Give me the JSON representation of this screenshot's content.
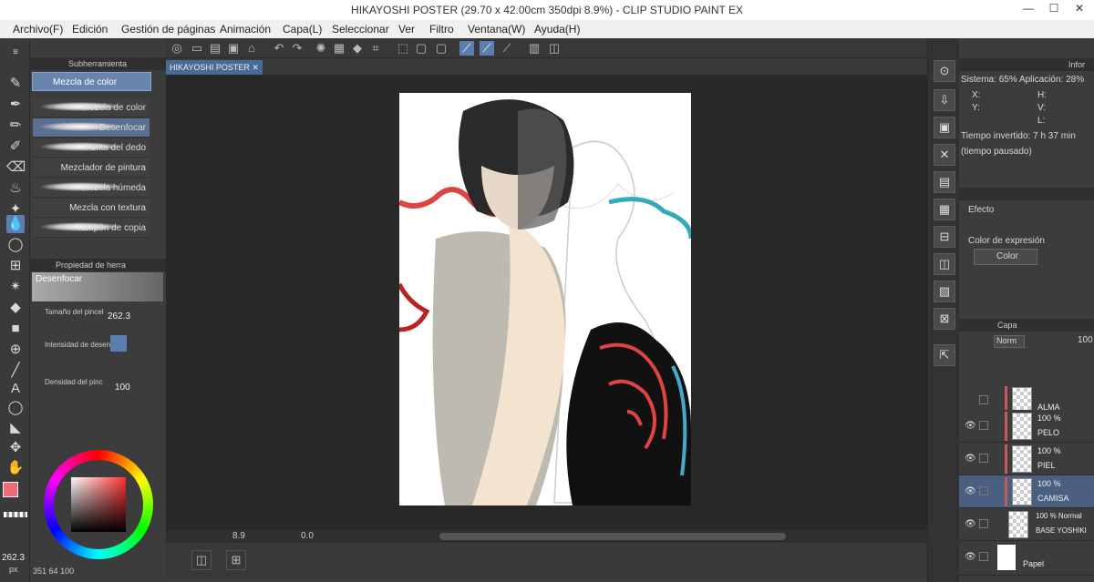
{
  "window": {
    "title": "HIKAYOSHI POSTER (29.70 x 42.00cm 350dpi 8.9%) - CLIP STUDIO PAINT EX",
    "minimize": "—",
    "maximize": "☐",
    "close": "✕"
  },
  "menu": [
    "Archivo(F)",
    "Edición",
    "Gestión de páginas",
    "Animación",
    "Capa(L)",
    "Seleccionar",
    "Ver",
    "Filtro",
    "Ventana(W)",
    "Ayuda(H)"
  ],
  "subtool": {
    "header": "Subherramienta",
    "group": "Mezcla de color",
    "items": [
      "Mezcla de color",
      "Desenfocar",
      "Punta del dedo",
      "Mezclador de pintura",
      "Mezcla húmeda",
      "Mezcla con textura",
      "Tampón de copia"
    ],
    "selected_index": 1
  },
  "tool_property": {
    "header": "Propiedad de herra",
    "title": "Desenfocar",
    "brush_size_label": "Tamaño del pincel",
    "brush_size": "262.3",
    "intensity_label": "Intensidad de desen",
    "density_label": "Densidad del pinc",
    "density": "100"
  },
  "color": {
    "main": "#f06a7a",
    "sub": "#111111",
    "brush_readout": "262.3",
    "brush_unit": "px",
    "values": {
      "a": "351",
      "b": "64",
      "c": "100"
    }
  },
  "canvas": {
    "tab": "HIKAYOSHI POSTER",
    "zoom": "8.9",
    "rotation": "0.0"
  },
  "navigator": {
    "system_label": "Sistema:",
    "system_pct": "65%",
    "app_label": "Aplicación:",
    "app_pct": "28%",
    "x": "X:",
    "y": "Y:",
    "h": "H:",
    "v": "V:",
    "l": "L:",
    "time_label": "Tiempo invertido: 7 h 37 min",
    "paused": "(tiempo pausado)",
    "header": "Infor"
  },
  "effect": {
    "label": "Efecto",
    "expr_label": "Color de expresión",
    "expr_value": "Color"
  },
  "layers": {
    "header": "Capa",
    "blend": "Norm",
    "opacity": "100",
    "items": [
      {
        "pct": "",
        "name": "ALMA"
      },
      {
        "pct": "100 %",
        "name": "PELO"
      },
      {
        "pct": "100 %",
        "name": "PIEL"
      },
      {
        "pct": "100 %",
        "name": "CAMISA"
      },
      {
        "pct": "100 % Normal",
        "name": "BASE YOSHIKI"
      },
      {
        "pct": "",
        "name": "Papel"
      }
    ],
    "selected_index": 3
  }
}
